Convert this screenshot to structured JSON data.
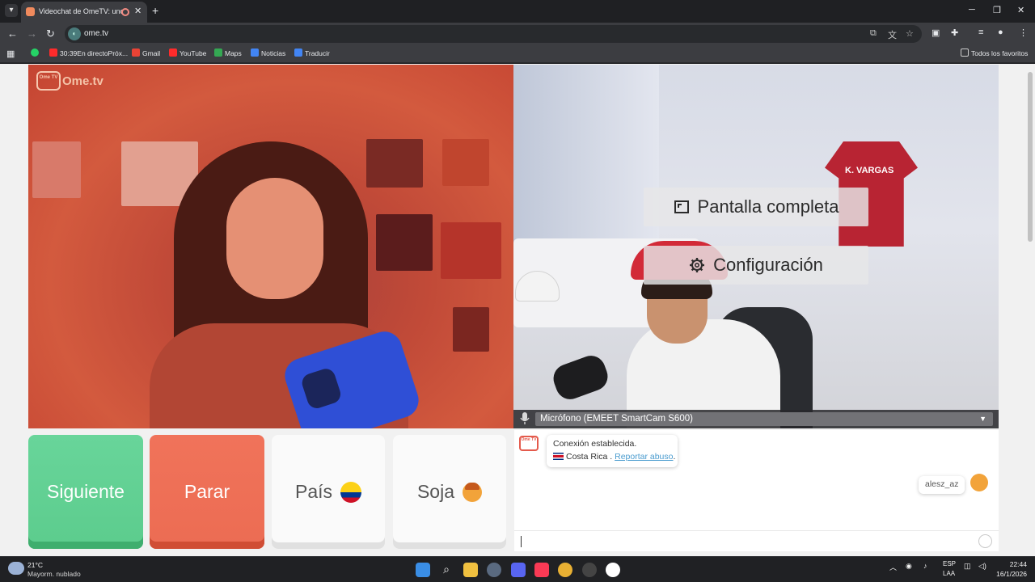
{
  "browser": {
    "tab_title": "Videochat de OmeTV: uno a",
    "url": "ome.tv",
    "bookmarks": [
      "30:39En directoPróx...",
      "Gmail",
      "YouTube",
      "Maps",
      "Noticias",
      "Traducir"
    ],
    "all_bookmarks": "Todos los favoritos"
  },
  "site": {
    "logo_badge": "Ome TV",
    "logo_text": "Ome.tv"
  },
  "remote_video": {
    "jersey_name": "K. VARGAS",
    "fullscreen_label": "Pantalla completa",
    "settings_label": "Configuración",
    "microphone_select": "Micrófono (EMEET SmartCam S600)"
  },
  "controls": {
    "next_label": "Siguiente",
    "stop_label": "Parar",
    "country_label": "País",
    "gender_label": "Soja"
  },
  "chat": {
    "status": "Conexión establecida.",
    "country": "Costa Rica .",
    "report_label": "Reportar abuso",
    "report_suffix": ".",
    "user_message": "alesz_az"
  },
  "taskbar": {
    "temperature": "21°C",
    "weather": "Mayorm. nublado",
    "lang_top": "ESP",
    "lang_bottom": "LAA",
    "time": "22:44",
    "date": "16/1/2026"
  }
}
